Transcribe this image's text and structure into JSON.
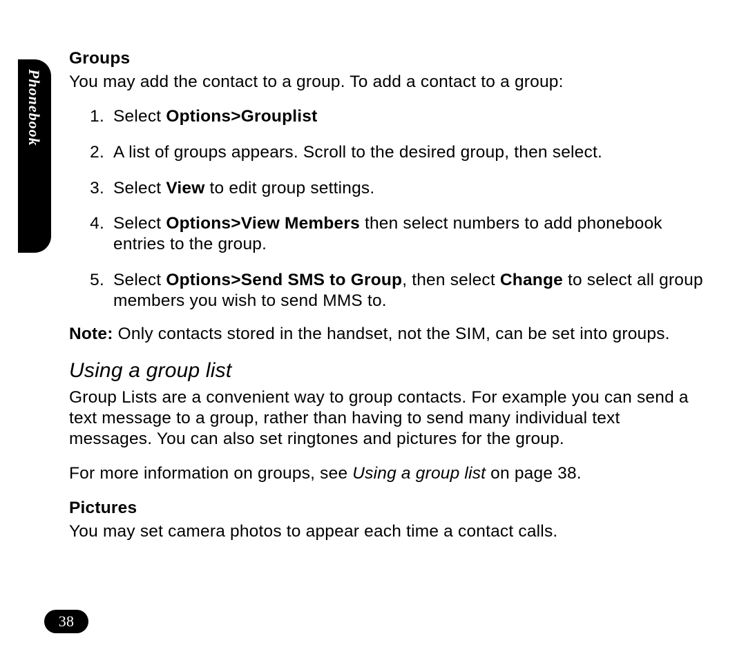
{
  "sideTab": "Phonebook",
  "pageNumber": "38",
  "groups": {
    "heading": "Groups",
    "intro": "You may add the contact to a group. To add a contact to a group:",
    "steps": {
      "s1_pre": "Select ",
      "s1_bold": "Options>Grouplist",
      "s2": "A list of groups appears. Scroll to the desired group, then select.",
      "s3_pre": "Select ",
      "s3_bold": "View",
      "s3_post": " to edit group settings.",
      "s4_pre": "Select ",
      "s4_bold": "Options>View Members",
      "s4_post": " then select numbers to add phonebook entries to the group.",
      "s5_pre": "Select ",
      "s5_bold1": "Options>Send SMS to Group",
      "s5_mid": ", then select ",
      "s5_bold2": "Change",
      "s5_post": " to select all group members you wish to send MMS to."
    },
    "note_label": "Note:",
    "note_text": " Only contacts stored in the handset, not the SIM, can be set into groups."
  },
  "usingGroupList": {
    "heading": "Using a group list",
    "p1": "Group Lists are a convenient way to group contacts. For example you can send a text message to a group, rather than having to send many individual text messages. You can also set ringtones and pictures for the group.",
    "p2_pre": "For more information on groups, see ",
    "p2_ref": "Using a group list",
    "p2_post": " on page 38."
  },
  "pictures": {
    "heading": "Pictures",
    "p1": "You may set camera photos to appear each time a contact calls."
  }
}
